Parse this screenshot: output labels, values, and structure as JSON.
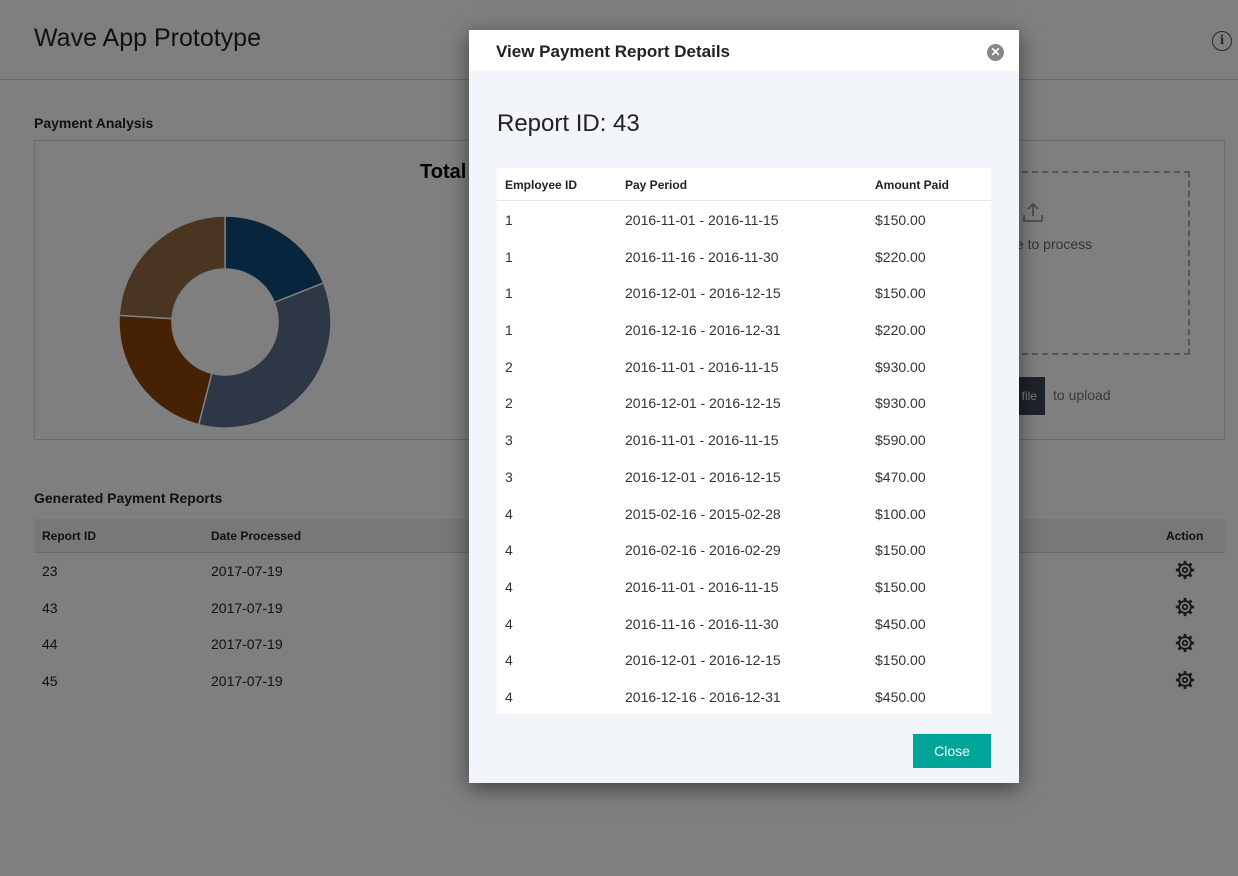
{
  "app": {
    "title": "Wave App Prototype",
    "info_icon": "info-icon"
  },
  "analysis": {
    "section_title": "Payment Analysis",
    "chart_title_partial": "Total",
    "dropzone_text_partial": "port file to process",
    "choose_button_partial": "file",
    "upload_hint": "to upload",
    "upload_icon": "upload-icon"
  },
  "chart_data": {
    "type": "pie",
    "donut": true,
    "title": "Total",
    "slices": [
      {
        "value": 19,
        "color": "#0f4a78"
      },
      {
        "value": 35,
        "color": "#5a6f8a"
      },
      {
        "value": 22,
        "color": "#8c4206"
      },
      {
        "value": 24,
        "color": "#936a45"
      }
    ]
  },
  "reports": {
    "section_title": "Generated Payment Reports",
    "headers": {
      "report_id": "Report ID",
      "date": "Date Processed",
      "action": "Action"
    },
    "rows": [
      {
        "id": "23",
        "date": "2017-07-19"
      },
      {
        "id": "43",
        "date": "2017-07-19"
      },
      {
        "id": "44",
        "date": "2017-07-19"
      },
      {
        "id": "45",
        "date": "2017-07-19"
      }
    ]
  },
  "modal": {
    "title": "View Payment Report Details",
    "report_heading": "Report ID: 43",
    "headers": {
      "employee": "Employee ID",
      "period": "Pay Period",
      "amount": "Amount Paid"
    },
    "rows": [
      {
        "emp": "1",
        "period": "2016-11-01 - 2016-11-15",
        "amount": "$150.00"
      },
      {
        "emp": "1",
        "period": "2016-11-16 - 2016-11-30",
        "amount": "$220.00"
      },
      {
        "emp": "1",
        "period": "2016-12-01 - 2016-12-15",
        "amount": "$150.00"
      },
      {
        "emp": "1",
        "period": "2016-12-16 - 2016-12-31",
        "amount": "$220.00"
      },
      {
        "emp": "2",
        "period": "2016-11-01 - 2016-11-15",
        "amount": "$930.00"
      },
      {
        "emp": "2",
        "period": "2016-12-01 - 2016-12-15",
        "amount": "$930.00"
      },
      {
        "emp": "3",
        "period": "2016-11-01 - 2016-11-15",
        "amount": "$590.00"
      },
      {
        "emp": "3",
        "period": "2016-12-01 - 2016-12-15",
        "amount": "$470.00"
      },
      {
        "emp": "4",
        "period": "2015-02-16 - 2015-02-28",
        "amount": "$100.00"
      },
      {
        "emp": "4",
        "period": "2016-02-16 - 2016-02-29",
        "amount": "$150.00"
      },
      {
        "emp": "4",
        "period": "2016-11-01 - 2016-11-15",
        "amount": "$150.00"
      },
      {
        "emp": "4",
        "period": "2016-11-16 - 2016-11-30",
        "amount": "$450.00"
      },
      {
        "emp": "4",
        "period": "2016-12-01 - 2016-12-15",
        "amount": "$150.00"
      },
      {
        "emp": "4",
        "period": "2016-12-16 - 2016-12-31",
        "amount": "$450.00"
      }
    ],
    "close_label": "Close",
    "close_icon": "close-icon"
  }
}
